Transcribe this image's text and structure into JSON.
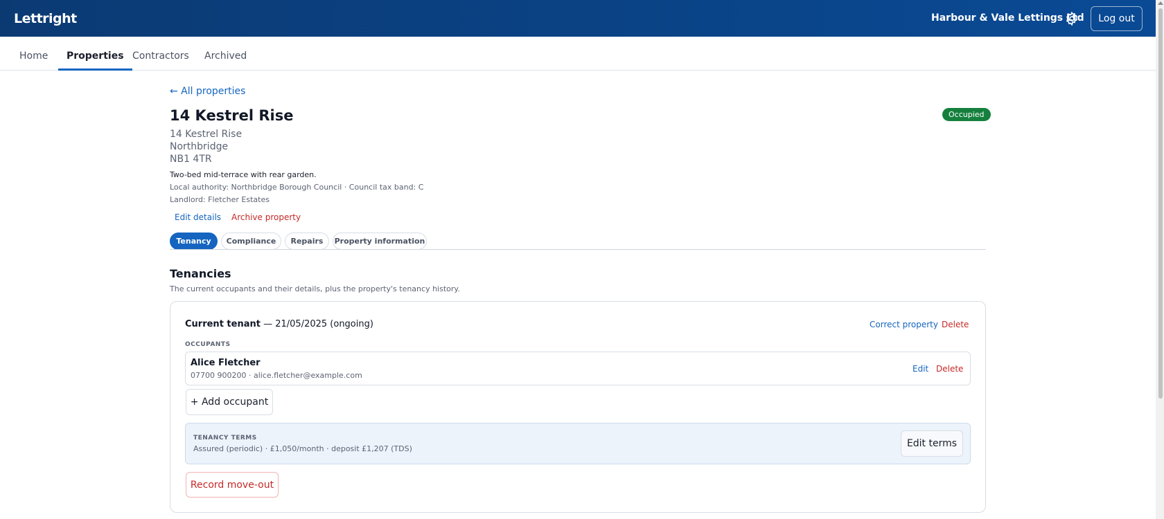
{
  "header": {
    "brand": "Lettright",
    "organisation": "Harbour & Vale Lettings Ltd",
    "settings_icon": "gear-icon",
    "logout_label": "Log out",
    "background": "#0b3a73"
  },
  "nav": {
    "items": [
      {
        "label": "Home",
        "active": false
      },
      {
        "label": "Properties",
        "active": true
      },
      {
        "label": "Contractors",
        "active": false
      },
      {
        "label": "Archived",
        "active": false
      }
    ]
  },
  "property": {
    "back_link": "← All properties",
    "title": "14 Kestrel Rise",
    "status": "Occupied",
    "status_color": "#15803d",
    "address": [
      "14 Kestrel Rise",
      "Northbridge",
      "NB1 4TR"
    ],
    "description": "Two-bed mid-terrace with rear garden.",
    "authority": "Local authority: Northbridge Borough Council · Council tax band: C",
    "landlord": "Landlord: Fletcher Estates",
    "edit_label": "Edit details",
    "archive_label": "Archive property"
  },
  "tabs": [
    {
      "label": "Tenancy",
      "active": true
    },
    {
      "label": "Compliance",
      "active": false
    },
    {
      "label": "Repairs",
      "active": false
    },
    {
      "label": "Property information",
      "active": false
    }
  ],
  "tenancies": {
    "title": "Tenancies",
    "subtitle": "The current occupants and their details, plus the property's tenancy history.",
    "current": {
      "label": "Current tenant",
      "dates": " — 21/05/2025 (ongoing)",
      "correct_label": "Correct property",
      "delete_label": "Delete",
      "occupants_heading": "OCCUPANTS",
      "occupants": [
        {
          "name": "Alice Fletcher",
          "contact": "07700 900200 · alice.fletcher@example.com",
          "edit_label": "Edit",
          "delete_label": "Delete"
        }
      ],
      "add_occupant_label": "+ Add occupant",
      "terms_heading": "TENANCY TERMS",
      "terms_value": "Assured (periodic) · £1,050/month · deposit £1,207 (TDS)",
      "edit_terms_label": "Edit terms",
      "move_out_label": "Record move-out"
    }
  }
}
